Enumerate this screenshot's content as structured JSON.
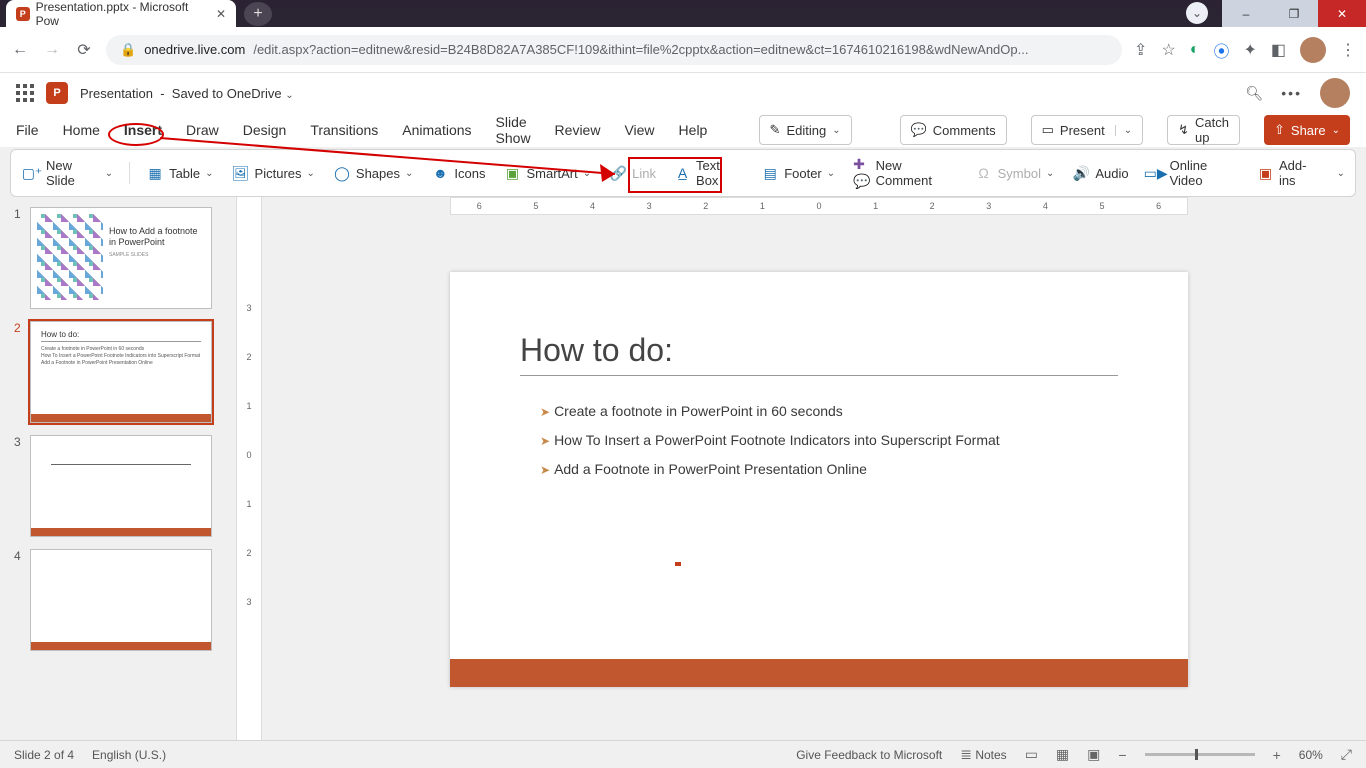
{
  "browser": {
    "tab_title": "Presentation.pptx - Microsoft Pow",
    "url_domain": "onedrive.live.com",
    "url_path": "/edit.aspx?action=editnew&resid=B24B8D82A7A385CF!109&ithint=file%2cpptx&action=editnew&ct=1674610216198&wdNewAndOp..."
  },
  "os_controls": {
    "min": "–",
    "max": "❐",
    "close": "✕"
  },
  "app": {
    "doc_name": "Presentation",
    "save_state": "Saved to OneDrive"
  },
  "menu": {
    "items": [
      "File",
      "Home",
      "Insert",
      "Draw",
      "Design",
      "Transitions",
      "Animations",
      "Slide Show",
      "Review",
      "View",
      "Help"
    ],
    "editing": "Editing",
    "comments": "Comments",
    "present": "Present",
    "catchup": "Catch up",
    "share": "Share"
  },
  "ribbon": {
    "new_slide": "New Slide",
    "table": "Table",
    "pictures": "Pictures",
    "shapes": "Shapes",
    "icons": "Icons",
    "smartart": "SmartArt",
    "link": "Link",
    "text_box": "Text Box",
    "footer": "Footer",
    "new_comment": "New Comment",
    "symbol": "Symbol",
    "audio": "Audio",
    "online_video": "Online Video",
    "addins": "Add-ins"
  },
  "ruler": {
    "h": [
      "6",
      "5",
      "4",
      "3",
      "2",
      "1",
      "0",
      "1",
      "2",
      "3",
      "4",
      "5",
      "6"
    ],
    "v": [
      "3",
      "2",
      "1",
      "0",
      "1",
      "2",
      "3"
    ]
  },
  "thumbs": {
    "t1_title": "How to Add a footnote in PowerPoint",
    "t1_sample": "SAMPLE SLIDES",
    "t2_h": "How to do:",
    "t2_li": [
      "Create a footnote in PowerPoint in 60 seconds",
      "How To Insert a PowerPoint Footnote Indicators into Superscript Format",
      "Add a Footnote in PowerPoint Presentation Online"
    ]
  },
  "slide": {
    "title": "How to do:",
    "items": [
      "Create a footnote in PowerPoint in 60 seconds",
      "How To Insert a PowerPoint Footnote Indicators into Superscript Format",
      "Add a Footnote in PowerPoint Presentation Online"
    ]
  },
  "status": {
    "slide_of": "Slide 2 of 4",
    "lang": "English (U.S.)",
    "feedback": "Give Feedback to Microsoft",
    "notes": "Notes",
    "zoom": "60%"
  }
}
